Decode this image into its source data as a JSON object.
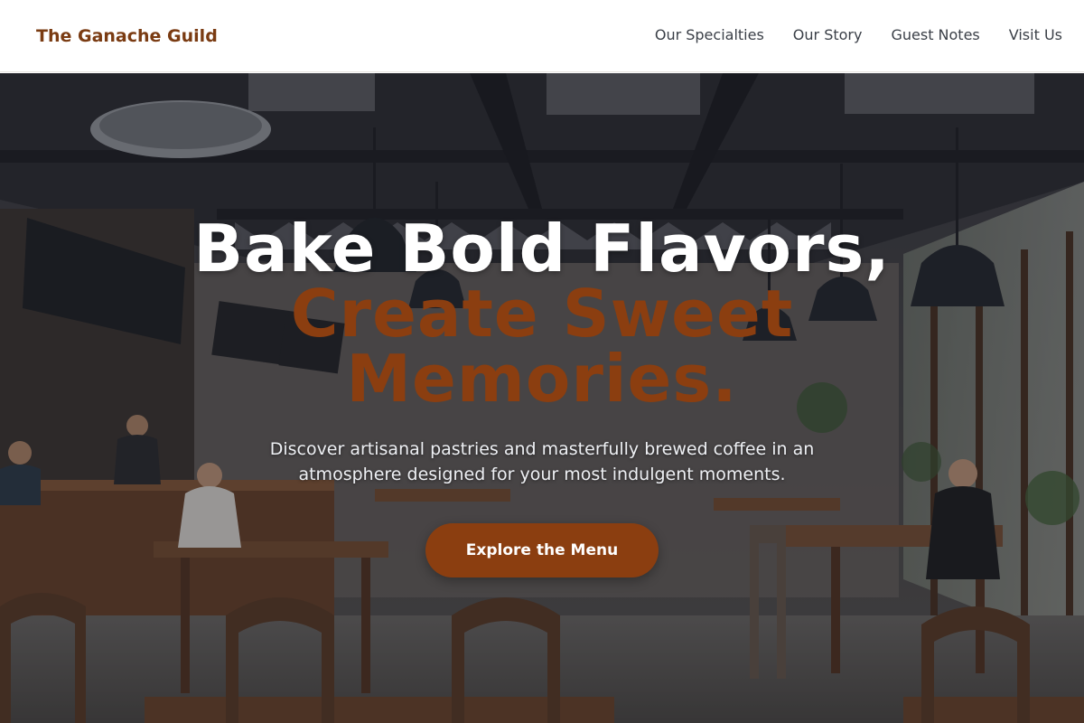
{
  "brand": {
    "name": "The Ganache Guild",
    "color": "#7a3b12"
  },
  "nav": {
    "items": [
      {
        "label": "Our Specialties"
      },
      {
        "label": "Our Story"
      },
      {
        "label": "Guest Notes"
      },
      {
        "label": "Visit Us"
      }
    ]
  },
  "hero": {
    "headline_line1": "Bake Bold Flavors,",
    "headline_line2": "Create Sweet Memories.",
    "subtitle": "Discover artisanal pastries and masterfully brewed coffee in an atmosphere designed for your most indulgent moments.",
    "cta_label": "Explore the Menu",
    "background_image": "cafe-interior-photo",
    "accent_color": "#8b3e10"
  }
}
